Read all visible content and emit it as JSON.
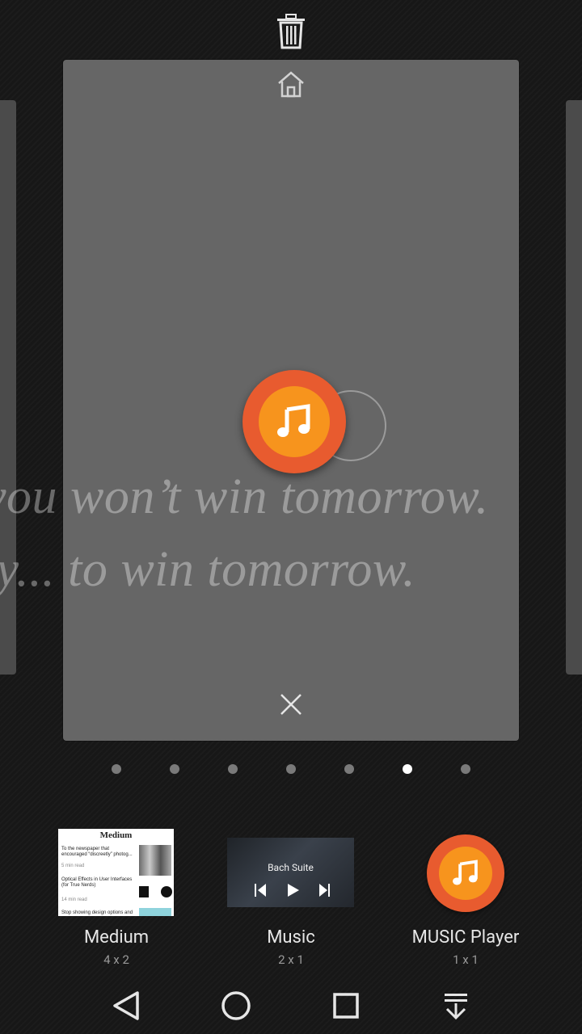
{
  "quote": {
    "line1": "you won’t win tomorrow.",
    "line2": "ay... to win tomorrow."
  },
  "pager": {
    "count": 7,
    "active_index": 5
  },
  "widgets": [
    {
      "name": "Medium",
      "size": "4 x 2"
    },
    {
      "name": "Music",
      "size": "2 x 1",
      "track": "Bach Suite"
    },
    {
      "name": "MUSIC Player",
      "size": "1 x 1"
    }
  ],
  "medium_preview": {
    "title": "Medium",
    "lines": [
      "To the newspaper that",
      "encouraged “discreetly” photog...",
      "5 min read",
      "Optical Effects in User Interfaces",
      "(for True Nerds)",
      "14 min read",
      "Stop showing design options and"
    ]
  },
  "colors": {
    "accent_orange": "#f7941d",
    "icon_ring_red": "#e85b2f",
    "dot_active": "#ffffff",
    "dot_inactive": "#7a7a7a"
  },
  "icons": {
    "trash": "trash-icon",
    "home": "home-icon",
    "close": "close-icon",
    "music_note": "music-note-icon",
    "nav_back": "back-triangle-icon",
    "nav_home": "home-circle-icon",
    "nav_recents": "recents-square-icon",
    "nav_notifications": "notifications-drawer-icon"
  }
}
